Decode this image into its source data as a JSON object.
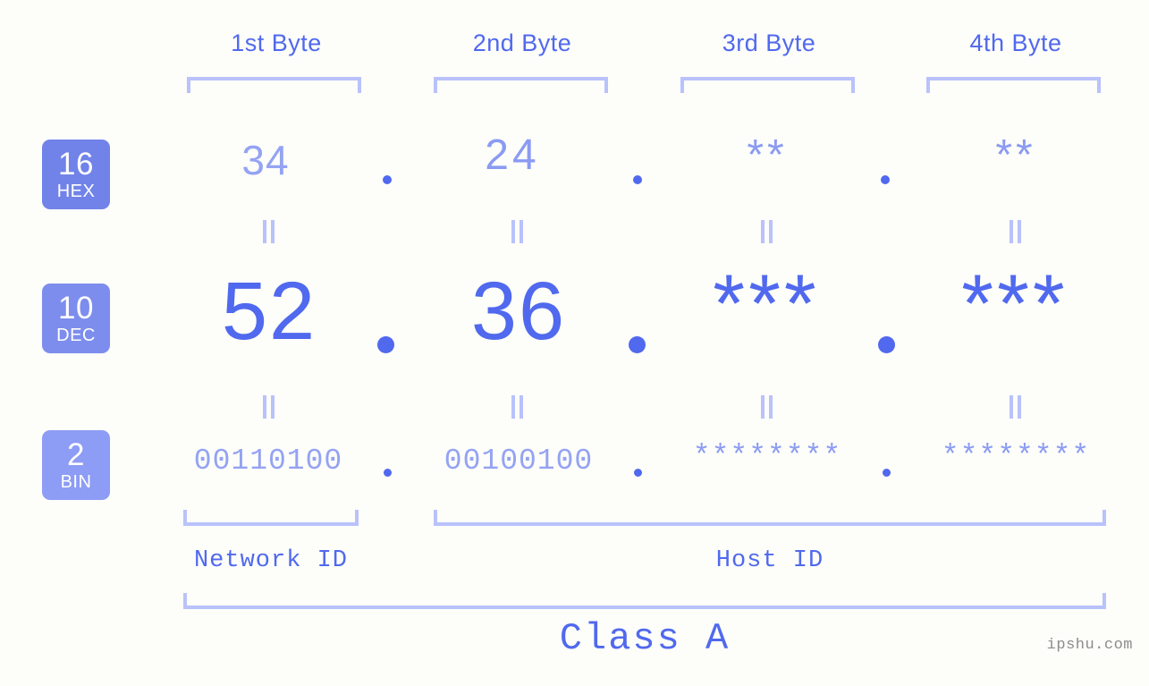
{
  "page": {
    "background_color": "#fdfdfa",
    "accent_color": "#5069ee",
    "muted_accent_color": "#94a3f3",
    "bracket_color": "#b9c2fb"
  },
  "byte_headers": [
    {
      "label": "1st Byte"
    },
    {
      "label": "2nd Byte"
    },
    {
      "label": "3rd Byte"
    },
    {
      "label": "4th Byte"
    }
  ],
  "bases": [
    {
      "number": "16",
      "name": "HEX",
      "color": "#7183e9"
    },
    {
      "number": "10",
      "name": "DEC",
      "color": "#7d8ded"
    },
    {
      "number": "2",
      "name": "BIN",
      "color": "#8d9cf4"
    }
  ],
  "rows": {
    "hex": {
      "base_number": "16",
      "base_name": "HEX",
      "bytes": [
        "34",
        "24",
        "**",
        "**"
      ]
    },
    "dec": {
      "base_number": "10",
      "base_name": "DEC",
      "bytes": [
        "52",
        "36",
        "***",
        "***"
      ]
    },
    "bin": {
      "base_number": "2",
      "base_name": "BIN",
      "bytes": [
        "00110100",
        "00100100",
        "********",
        "********"
      ]
    }
  },
  "separator": ".",
  "equality_symbol": "=",
  "segments": {
    "network_id": "Network ID",
    "host_id": "Host ID"
  },
  "class_label": "Class A",
  "watermark": "ipshu.com"
}
